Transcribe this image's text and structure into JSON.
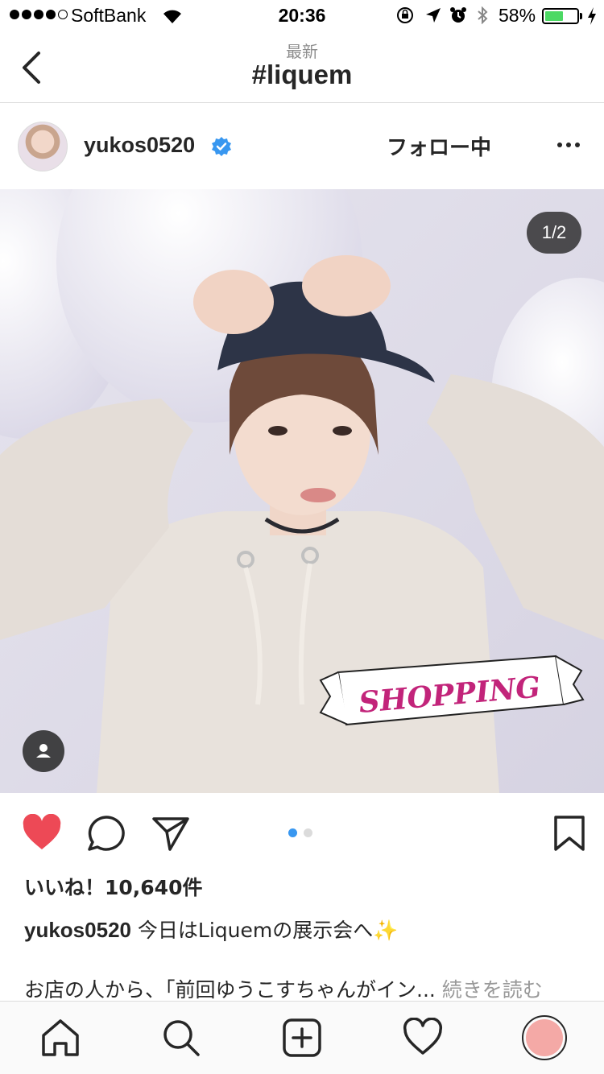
{
  "status_bar": {
    "carrier": "SoftBank",
    "time": "20:36",
    "battery_percent": "58%",
    "battery_level": 0.58
  },
  "nav": {
    "subtitle": "最新",
    "title": "#liquem"
  },
  "post": {
    "username": "yukos0520",
    "follow_label": "フォロー中",
    "page_indicator": "1/2",
    "sticker_text": "SHOPPING",
    "likes": "いいね！10,640件",
    "caption_user": "yukos0520",
    "caption_text": " 今日はLiquemの展示会へ✨",
    "caption_line2": "お店の人から、「前回ゆうこすちゃんがイン...",
    "read_more": " 続きを読む",
    "carousel_total": 2,
    "carousel_current": 1
  },
  "icons": {
    "back": "chevron-left-icon",
    "verified": "verified-badge-icon",
    "like": "heart-filled-icon",
    "comment": "comment-icon",
    "share": "send-icon",
    "save": "bookmark-icon",
    "home": "home-icon",
    "search": "search-icon",
    "add": "add-icon",
    "activity": "heart-outline-icon"
  },
  "colors": {
    "like_red": "#ed4956",
    "verified_blue": "#3897f0",
    "battery_green": "#4cd964"
  }
}
